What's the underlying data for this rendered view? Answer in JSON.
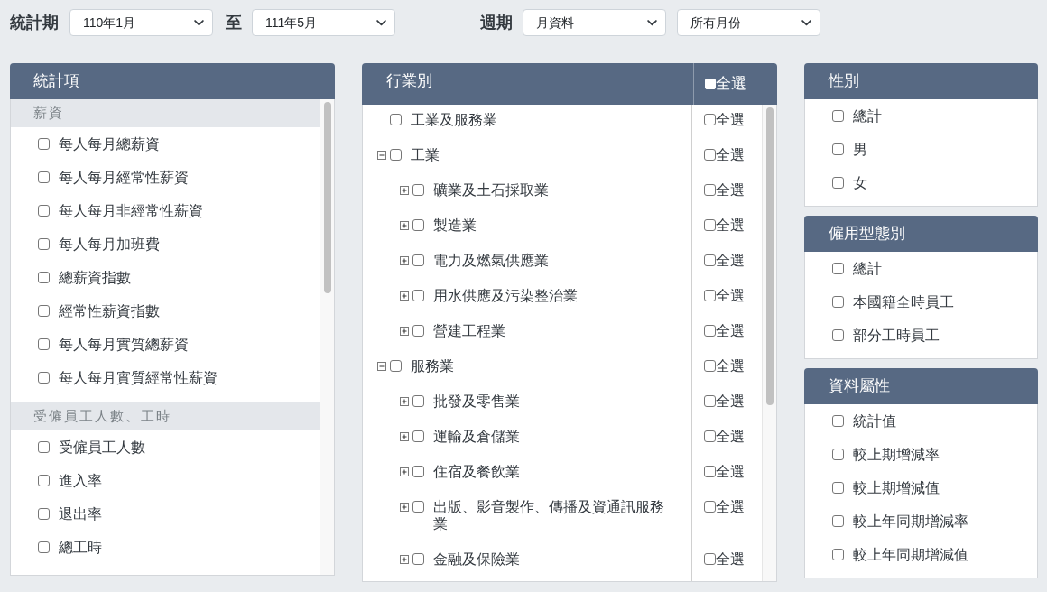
{
  "period": {
    "label": "統計期",
    "from": "110年1月",
    "separator": "至",
    "to": "111年5月"
  },
  "frequency": {
    "label": "週期",
    "value": "月資料",
    "months": "所有月份"
  },
  "statistic_items": {
    "title": "統計項",
    "groups": [
      {
        "label": "薪資",
        "items": [
          {
            "label": "每人每月總薪資",
            "checked": false
          },
          {
            "label": "每人每月經常性薪資",
            "checked": false
          },
          {
            "label": "每人每月非經常性薪資",
            "checked": false
          },
          {
            "label": "每人每月加班費",
            "checked": false
          },
          {
            "label": "總薪資指數",
            "checked": false
          },
          {
            "label": "經常性薪資指數",
            "checked": false
          },
          {
            "label": "每人每月實質總薪資",
            "checked": false
          },
          {
            "label": "每人每月實質經常性薪資",
            "checked": false
          }
        ]
      },
      {
        "label": "受僱員工人數、工時",
        "items": [
          {
            "label": "受僱員工人數",
            "checked": false
          },
          {
            "label": "進入率",
            "checked": false
          },
          {
            "label": "退出率",
            "checked": false
          },
          {
            "label": "總工時",
            "checked": false
          }
        ]
      }
    ]
  },
  "industry": {
    "title": "行業別",
    "select_all": {
      "label": "全選",
      "checked": false
    },
    "tree": [
      {
        "kind": "total",
        "label": "工業及服務業",
        "checked": false,
        "select_all": {
          "label": "全選",
          "checked": false
        }
      },
      {
        "kind": "branch",
        "label": "工業",
        "expanded": true,
        "checked": false,
        "select_all": {
          "label": "全選",
          "checked": false
        },
        "children": [
          {
            "kind": "branch",
            "label": "礦業及土石採取業",
            "expanded": false,
            "checked": false,
            "select_all": {
              "label": "全選",
              "checked": false
            }
          },
          {
            "kind": "branch",
            "label": "製造業",
            "expanded": false,
            "checked": false,
            "select_all": {
              "label": "全選",
              "checked": false
            }
          },
          {
            "kind": "branch",
            "label": "電力及燃氣供應業",
            "expanded": false,
            "checked": false,
            "select_all": {
              "label": "全選",
              "checked": false
            }
          },
          {
            "kind": "branch",
            "label": "用水供應及污染整治業",
            "expanded": false,
            "checked": false,
            "select_all": {
              "label": "全選",
              "checked": false
            }
          },
          {
            "kind": "branch",
            "label": "營建工程業",
            "expanded": false,
            "checked": false,
            "select_all": {
              "label": "全選",
              "checked": false
            }
          }
        ]
      },
      {
        "kind": "branch",
        "label": "服務業",
        "expanded": true,
        "checked": false,
        "select_all": {
          "label": "全選",
          "checked": false
        },
        "children": [
          {
            "kind": "branch",
            "label": "批發及零售業",
            "expanded": false,
            "checked": false,
            "select_all": {
              "label": "全選",
              "checked": false
            }
          },
          {
            "kind": "branch",
            "label": "運輸及倉儲業",
            "expanded": false,
            "checked": false,
            "select_all": {
              "label": "全選",
              "checked": false
            }
          },
          {
            "kind": "branch",
            "label": "住宿及餐飲業",
            "expanded": false,
            "checked": false,
            "select_all": {
              "label": "全選",
              "checked": false
            }
          },
          {
            "kind": "branch",
            "label": "出版、影音製作、傳播及資通訊服務業",
            "expanded": false,
            "checked": false,
            "select_all": {
              "label": "全選",
              "checked": false
            }
          },
          {
            "kind": "branch",
            "label": "金融及保險業",
            "expanded": false,
            "checked": false,
            "select_all": {
              "label": "全選",
              "checked": false
            }
          }
        ]
      }
    ]
  },
  "side_panels": [
    {
      "title": "性別",
      "options": [
        {
          "label": "總計",
          "checked": false
        },
        {
          "label": "男",
          "checked": false
        },
        {
          "label": "女",
          "checked": false
        }
      ]
    },
    {
      "title": "僱用型態別",
      "options": [
        {
          "label": "總計",
          "checked": false
        },
        {
          "label": "本國籍全時員工",
          "checked": false
        },
        {
          "label": "部分工時員工",
          "checked": false
        }
      ]
    },
    {
      "title": "資料屬性",
      "options": [
        {
          "label": "統計值",
          "checked": false
        },
        {
          "label": "較上期增減率",
          "checked": false
        },
        {
          "label": "較上期增減值",
          "checked": false
        },
        {
          "label": "較上年同期增減率",
          "checked": false
        },
        {
          "label": "較上年同期增減值",
          "checked": false
        }
      ]
    }
  ]
}
